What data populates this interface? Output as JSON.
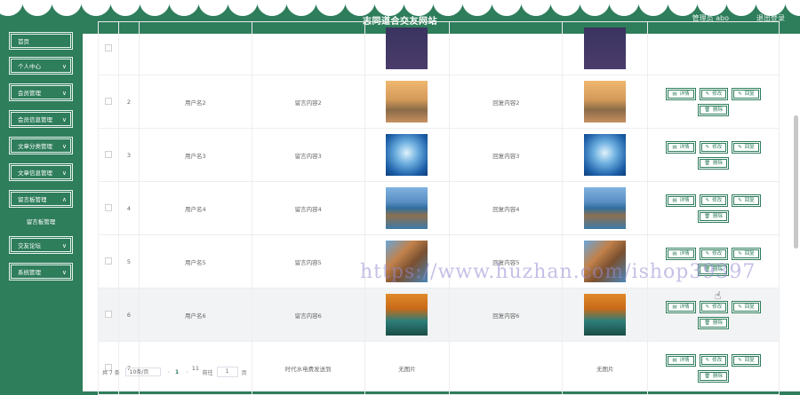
{
  "header": {
    "title": "志同道合交友网站",
    "user": "管理员 abo",
    "logout": "退出登录"
  },
  "sidebar": {
    "items": [
      {
        "label": "首页"
      },
      {
        "label": "个人中心",
        "chevron": "∨"
      },
      {
        "label": "会员管理",
        "chevron": "∨"
      },
      {
        "label": "会员信息管理",
        "chevron": "∨"
      },
      {
        "label": "文章分类管理",
        "chevron": "∨"
      },
      {
        "label": "文章信息管理",
        "chevron": "∨"
      },
      {
        "label": "留言板管理",
        "chevron": "∧"
      },
      {
        "label": "留言板管理"
      },
      {
        "label": "交友论坛",
        "chevron": "∨"
      },
      {
        "label": "系统管理",
        "chevron": "∨"
      }
    ]
  },
  "table": {
    "rows": [
      {
        "index": "2",
        "user": "用户名2",
        "message": "留言内容2",
        "reply": "回复内容2",
        "image": "sunset-beach",
        "reply_image": "sunset-beach"
      },
      {
        "index": "3",
        "user": "用户名3",
        "message": "留言内容3",
        "reply": "回复内容3",
        "image": "blue-sky",
        "reply_image": "blue-sky"
      },
      {
        "index": "4",
        "user": "用户名4",
        "message": "留言内容4",
        "reply": "回复内容4",
        "image": "coast-lake",
        "reply_image": "coast-lake"
      },
      {
        "index": "5",
        "user": "用户名5",
        "message": "留言内容5",
        "reply": "回复内容5",
        "image": "rock-cliff",
        "reply_image": "rock-cliff"
      },
      {
        "index": "6",
        "user": "用户名6",
        "message": "留言内容6",
        "reply": "回复内容6",
        "image": "autumn-lake",
        "reply_image": "autumn-lake"
      },
      {
        "index": "7",
        "user": "11",
        "message": "时代水电费发送到",
        "reply": "",
        "image_text": "无图片",
        "reply_image_text": "无图片"
      }
    ],
    "actions": {
      "detail": "详情",
      "edit": "修改",
      "reply": "回复",
      "delete": "删除"
    }
  },
  "pagination": {
    "total": "共 7 条",
    "page_size": "10条/页",
    "prev": "‹",
    "current": "1",
    "next": "›",
    "goto_label": "前往",
    "goto_value": "1",
    "unit": "页"
  },
  "watermark": "https://www.huzhan.com/ishop39397",
  "colors": {
    "primary": "#2e7d5b",
    "text": "#666666",
    "border": "#eceeef"
  }
}
